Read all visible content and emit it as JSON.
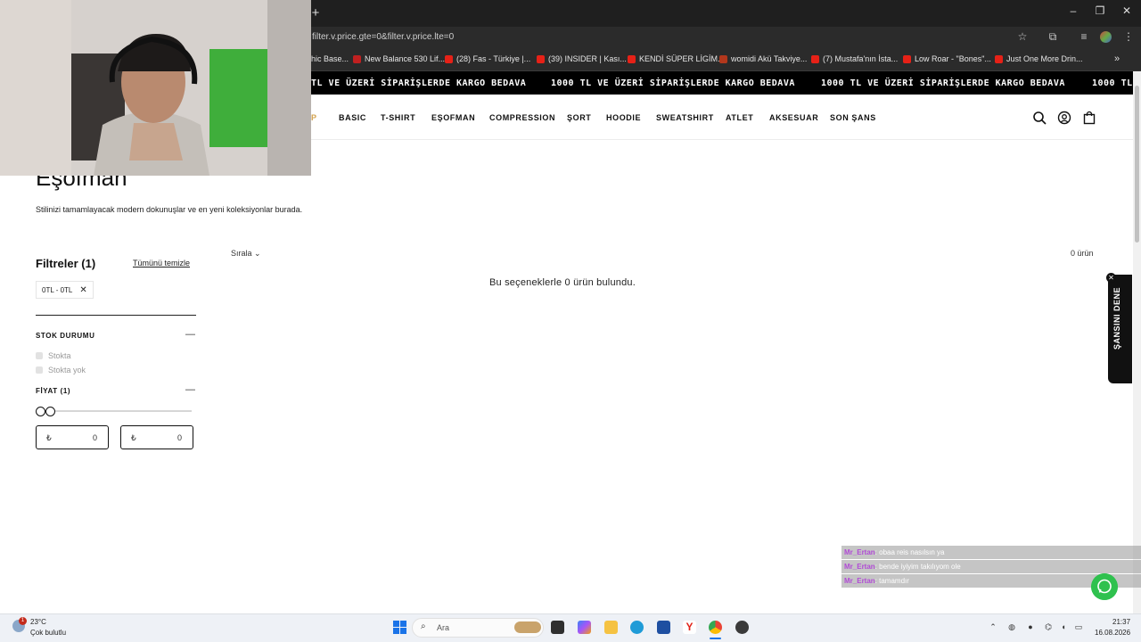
{
  "browser": {
    "url": "filter.v.price.gte=0&filter.v.price.lte=0",
    "bookmarks": [
      {
        "label": "hic Base..."
      },
      {
        "label": "New Balance 530 Lif..."
      },
      {
        "label": "(28) Fas - Türkiye |..."
      },
      {
        "label": "(39) INSIDER | Kası..."
      },
      {
        "label": "KENDİ SÜPER LİGİM..."
      },
      {
        "label": "womidi Akü Takviye..."
      },
      {
        "label": "(7) Mustafa'nın İsta..."
      },
      {
        "label": "Low Roar - \"Bones\"..."
      },
      {
        "label": "Just One More Drin..."
      }
    ]
  },
  "announcement": {
    "text": "1000 TL VE ÜZERİ SİPARİŞLERDE KARGO BEDAVA",
    "partial_left": "TL VE ÜZERİ SİPARİŞLERDE KARGO BEDAVA",
    "partial_right": "1000 TL"
  },
  "nav": {
    "partial": "P",
    "items": [
      "BASIC",
      "T-SHIRT",
      "EŞOFMAN",
      "COMPRESSION",
      "ŞORT",
      "HOODIE",
      "SWEATSHIRT",
      "ATLET",
      "AKSESUAR",
      "SON ŞANS"
    ]
  },
  "collection": {
    "title": "Eşofman",
    "description": "Stilinizi tamamlayacak modern dokunuşlar ve en yeni koleksiyonlar burada."
  },
  "filters": {
    "title": "Filtreler (1)",
    "clear_all": "Tümünü temizle",
    "active_chip": "0TL - 0TL",
    "stock": {
      "title": "STOK DURUMU",
      "options": [
        "Stokta",
        "Stokta yok"
      ]
    },
    "price": {
      "title": "FİYAT (1)",
      "currency": "₺",
      "min_value": "0",
      "max_value": "0"
    }
  },
  "results": {
    "sort_label": "Sırala",
    "count": "0 ürün",
    "empty_message": "Bu seçeneklerle 0 ürün bulundu."
  },
  "promo_tab": {
    "label": "ŞANSINI DENE"
  },
  "chat": [
    {
      "user": "Mr_Ertan",
      "message": ": obaa reis nasılsın ya"
    },
    {
      "user": "Mr_Ertan",
      "message": ": bende iyiyim takılıyom ole"
    },
    {
      "user": "Mr_Ertan",
      "message": ": tamamdır"
    }
  ],
  "taskbar": {
    "weather_temp": "23°C",
    "weather_desc": "Çok bulutlu",
    "notification_count": "1",
    "search_placeholder": "Ara",
    "time": "21:37",
    "date": "16.08.2026"
  }
}
